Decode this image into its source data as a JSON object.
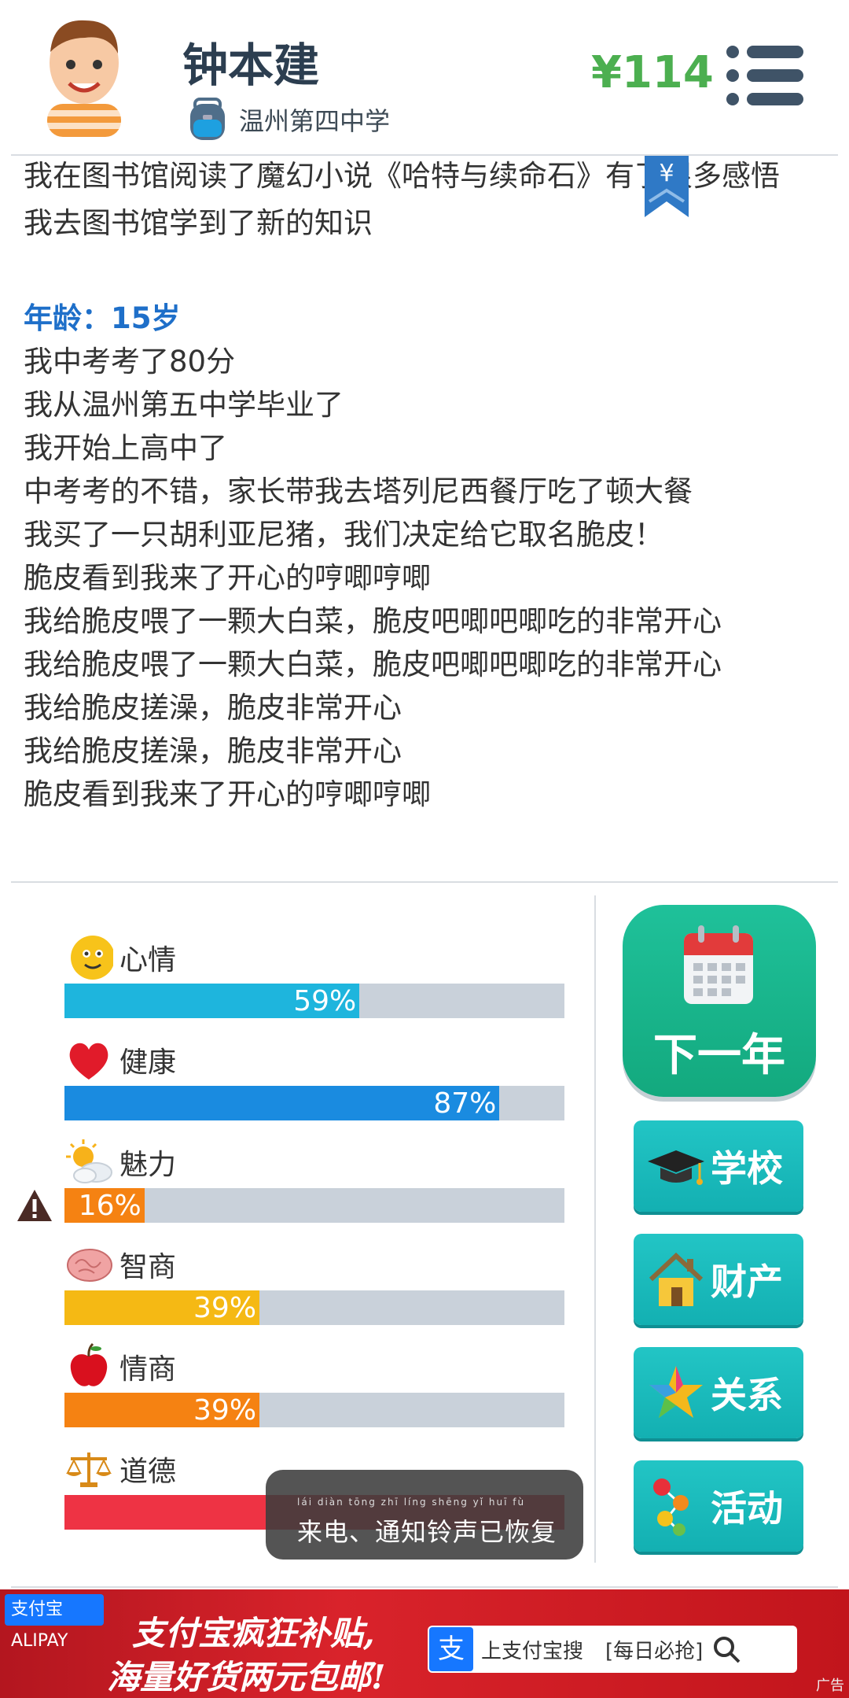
{
  "header": {
    "name": "钟本建",
    "school": "温州第四中学",
    "money": "¥114"
  },
  "log": {
    "lines_top": [
      "我在图书馆阅读了魔幻小说《哈特与续命石》有了很多感悟",
      "我去图书馆学到了新的知识"
    ],
    "age_label": "年龄：15岁",
    "lines_age": [
      "我中考考了80分",
      "我从温州第五中学毕业了",
      "我开始上高中了",
      "中考考的不错，家长带我去塔列尼西餐厅吃了顿大餐",
      "我买了一只胡利亚尼猪，我们决定给它取名脆皮！",
      "脆皮看到我来了开心的哼唧哼唧",
      "我给脆皮喂了一颗大白菜，脆皮吧唧吧唧吃的非常开心",
      "我给脆皮喂了一颗大白菜，脆皮吧唧吧唧吃的非常开心",
      "我给脆皮搓澡，脆皮非常开心",
      "我给脆皮搓澡，脆皮非常开心",
      "脆皮看到我来了开心的哼唧哼唧"
    ],
    "ribbon_symbol": "¥"
  },
  "stats": [
    {
      "label": "心情",
      "value": 59,
      "pct": "59%",
      "color": "#1eb5dd",
      "icon": "smiley-icon"
    },
    {
      "label": "健康",
      "value": 87,
      "pct": "87%",
      "color": "#1a8be0",
      "icon": "heart-icon"
    },
    {
      "label": "魅力",
      "value": 16,
      "pct": "16%",
      "color": "#f58212",
      "icon": "weather-icon",
      "warning": true
    },
    {
      "label": "智商",
      "value": 39,
      "pct": "39%",
      "color": "#f5b914",
      "icon": "brain-icon"
    },
    {
      "label": "情商",
      "value": 39,
      "pct": "39%",
      "color": "#f58212",
      "icon": "apple-icon"
    },
    {
      "label": "道德",
      "value": 100,
      "pct": "",
      "color": "#ee3344",
      "icon": "scales-icon"
    }
  ],
  "buttons": {
    "next_year": "下一年",
    "school": "学校",
    "property": "财产",
    "relations": "关系",
    "activities": "活动"
  },
  "toast": {
    "pinyin": "lái diàn   tōng zhī líng shēng yǐ huī fù",
    "text": "来电、通知铃声已恢复"
  },
  "ad": {
    "logo_text": "支付宝 ALIPAY",
    "line1": "支付宝疯狂补贴,",
    "line2": "海量好货两元包邮!",
    "search_prefix": "上支付宝搜",
    "search_keyword": "[每日必抢]",
    "tag": "广告"
  }
}
